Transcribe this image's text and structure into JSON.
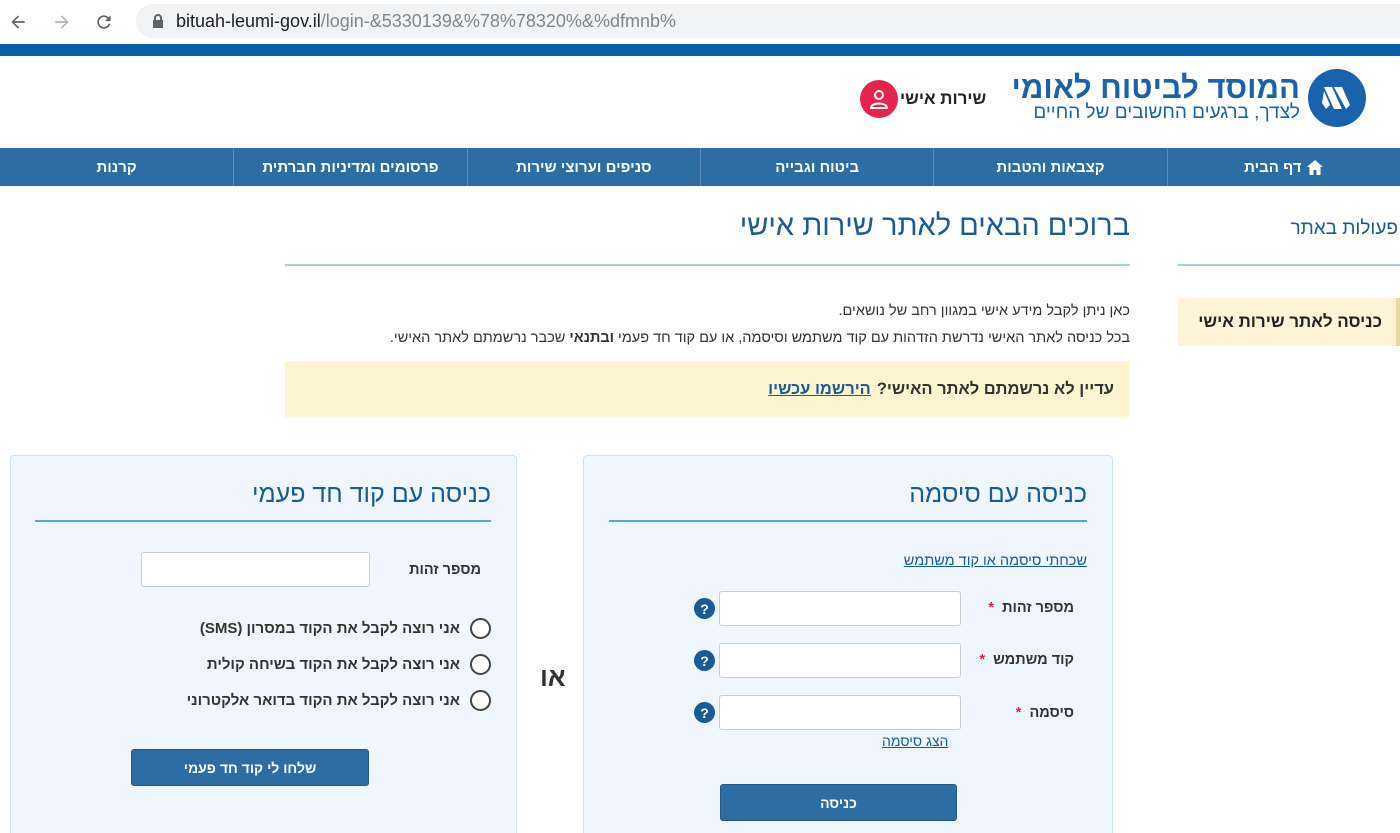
{
  "browser": {
    "url_domain": "bituah-leumi-gov.il",
    "url_path": "/login-&5330139&%78%78320%&%dfmnb%"
  },
  "header": {
    "logo_title": "המוסד לביטוח לאומי",
    "logo_subtitle": "לצדך, ברגעים החשובים של החיים",
    "personal_service": "שירות אישי"
  },
  "nav": {
    "items": [
      {
        "label": "דף הבית",
        "icon": "home-icon"
      },
      {
        "label": "קצבאות והטבות"
      },
      {
        "label": "ביטוח וגבייה"
      },
      {
        "label": "סניפים וערוצי שירות"
      },
      {
        "label": "פרסומים ומדיניות חברתית"
      },
      {
        "label": "קרנות"
      }
    ]
  },
  "sidebar": {
    "title": "פעולות באתר",
    "active_item": "כניסה לאתר שירות אישי"
  },
  "content": {
    "title": "ברוכים הבאים לאתר שירות אישי",
    "intro_line1": "כאן ניתן לקבל מידע אישי במגוון רחב של נושאים.",
    "intro_line2_a": "בכל כניסה לאתר האישי נדרשת הזדהות עם קוד משתמש וסיסמה, או עם קוד חד פעמי",
    "intro_line2_bold": "ובתנאי",
    "intro_line2_b": "שכבר נרשמתם לאתר האישי.",
    "register_question": "עדיין לא נרשמתם לאתר האישי?",
    "register_link": "הירשמו עכשיו"
  },
  "login_password": {
    "title": "כניסה עם סיסמה",
    "forgot_link": "שכחתי סיסמה או קוד משתמש",
    "id_label": "מספר זהות",
    "username_label": "קוד משתמש",
    "password_label": "סיסמה",
    "required_mark": "*",
    "help_mark": "?",
    "show_password": "הצג סיסמה",
    "submit": "כניסה"
  },
  "or_text": "או",
  "login_otp": {
    "title": "כניסה עם קוד חד פעמי",
    "id_label": "מספר זהות",
    "options": [
      "אני רוצה לקבל את הקוד במסרון (SMS)",
      "אני רוצה לקבל את הקוד בשיחה קולית",
      "אני רוצה לקבל את הקוד בדואר אלקטרוני"
    ],
    "submit": "שלחו לי קוד חד פעמי"
  },
  "colors": {
    "brand_blue": "#1a62ab",
    "nav_blue": "#2e6da4",
    "accent_red": "#e4234f",
    "notice_yellow": "#fdf5cf"
  }
}
